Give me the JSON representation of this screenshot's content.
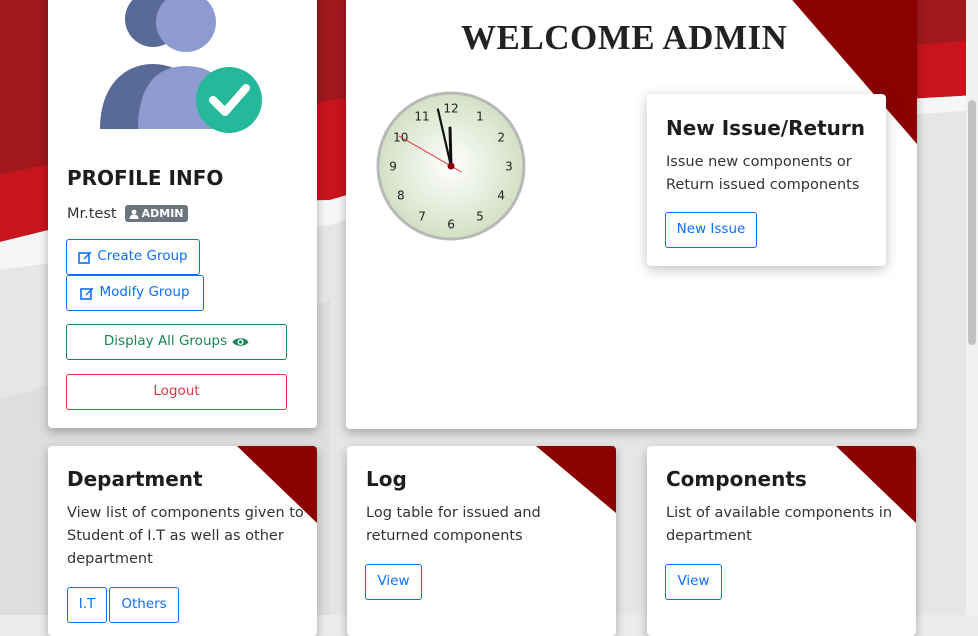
{
  "profile": {
    "heading": "PROFILE INFO",
    "username": "Mr.test",
    "role_badge": "ADMIN",
    "buttons": {
      "create_group": "Create Group",
      "modify_group": "Modify Group",
      "display_all_groups": "Display All Groups",
      "logout": "Logout"
    }
  },
  "welcome": {
    "title": "WELCOME ADMIN",
    "clock": {
      "numerals": [
        "12",
        "1",
        "2",
        "3",
        "4",
        "5",
        "6",
        "7",
        "8",
        "9",
        "10",
        "11"
      ],
      "time": {
        "hour": 11,
        "minute": 57,
        "second": 50
      }
    }
  },
  "new_issue": {
    "title": "New Issue/Return",
    "description": "Issue new components or Return issued components",
    "button": "New Issue"
  },
  "department": {
    "title": "Department",
    "description": "View list of components given to Student of I.T as well as other department",
    "buttons": [
      "I.T",
      "Others"
    ]
  },
  "log": {
    "title": "Log",
    "description": "Log table for issued and returned components",
    "button": "View"
  },
  "components": {
    "title": "Components",
    "description": "List of available components in department",
    "button": "View"
  },
  "colors": {
    "accent_dark_red": "#8b0000",
    "bg_red": "#c8141c",
    "primary_blue": "#0d6efd",
    "success_green": "#198754",
    "danger_red": "#dc3545",
    "avatar_back": "#5a6a97",
    "avatar_front": "#8d9bd0",
    "check_green": "#26b89a",
    "badge_gray": "#6c757d"
  }
}
